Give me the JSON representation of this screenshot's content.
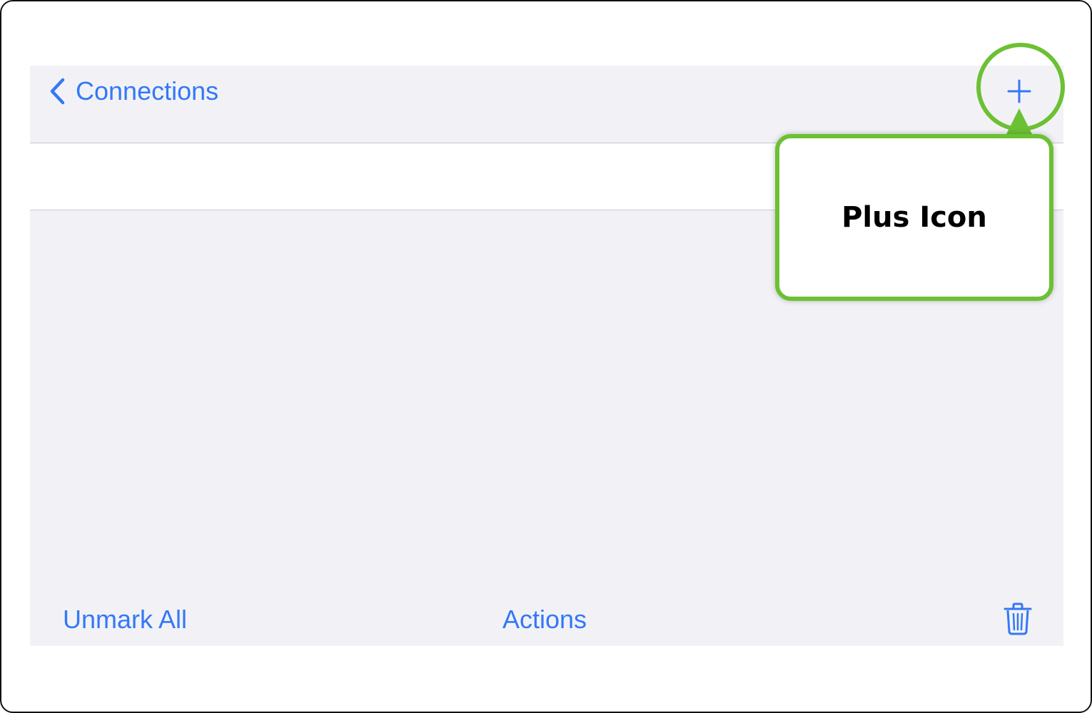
{
  "navbar": {
    "back_label": "Connections",
    "back_icon": "chevron-left-icon",
    "add_icon": "plus-icon"
  },
  "toolbar": {
    "unmark_all_label": "Unmark All",
    "actions_label": "Actions",
    "trash_icon": "trash-icon"
  },
  "annotation": {
    "callout_text": "Plus Icon",
    "highlight_color": "#6cc133"
  },
  "colors": {
    "accent": "#3478f6",
    "background": "#f2f2f6",
    "row_background": "#ffffff"
  }
}
